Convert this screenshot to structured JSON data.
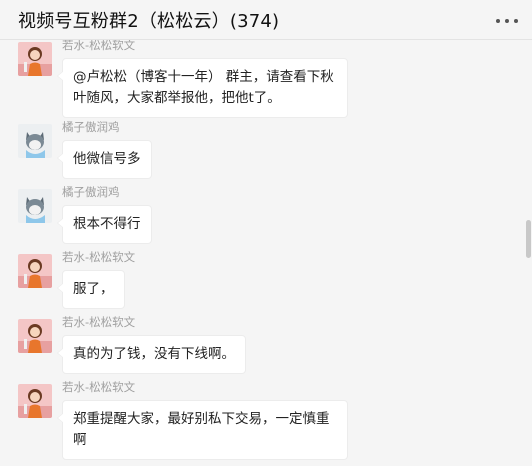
{
  "header": {
    "title": "视频号互粉群2（松松云）(374)",
    "more_icon": "more-horizontal-icon"
  },
  "messages": [
    {
      "sender": "若水-松松软文",
      "text": "@卢松松（博客十一年） 群主，请查看下秋叶随风，大家都举报他，把他t了。",
      "avatar_icon": "girl-avatar-icon"
    },
    {
      "sender": "橘子傲润鸡",
      "text": "他微信号多",
      "avatar_icon": "cat-avatar-icon"
    },
    {
      "sender": "橘子傲润鸡",
      "text": "根本不得行",
      "avatar_icon": "cat-avatar-icon"
    },
    {
      "sender": "若水-松松软文",
      "text": "服了，",
      "avatar_icon": "girl-avatar-icon"
    },
    {
      "sender": "若水-松松软文",
      "text": "真的为了钱，没有下线啊。",
      "avatar_icon": "girl-avatar-icon"
    },
    {
      "sender": "若水-松松软文",
      "text": "郑重提醒大家，最好别私下交易，一定慎重啊",
      "avatar_icon": "girl-avatar-icon"
    }
  ],
  "colors": {
    "background": "#f5f5f5",
    "bubble": "#ffffff",
    "sender_name": "#a0a0a0"
  }
}
